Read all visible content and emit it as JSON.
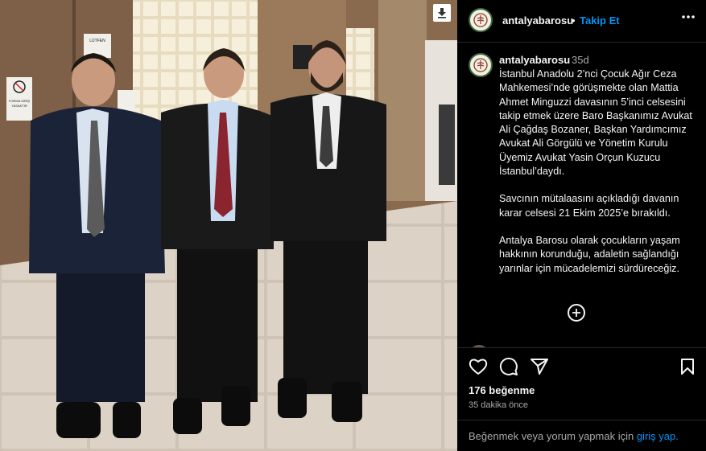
{
  "post": {
    "username": "antalyabarosu",
    "separator": "•",
    "follow_label": "Takip Et",
    "more_label": "•••",
    "caption_time": "35d",
    "caption": [
      "İstanbul Anadolu 2’nci Çocuk Ağır Ceza Mahkemesi’nde görüşmekte olan Mattia Ahmet Minguzzi davasının 5’inci celsesini takip etmek üzere Baro Başkanımız Avukat Ali Çağdaş Bozaner, Başkan Yardımcımız Avukat Ali Görgülü ve Yönetim Kurulu Üyemiz Avukat Yasin Orçun Kuzucu İstanbul’daydı.",
      "Savcının mütalaasını açıkladığı davanın karar celsesi 21 Ekim 2025’e bırakıldı.",
      "Antalya Barosu olarak çocukların yaşam hakkının korunduğu, adaletin sağlandığı yarınlar için mücadelemizi sürdüreceğiz."
    ],
    "likes": "176 beğenme",
    "time_ago": "35 dakika önce",
    "login_prompt": "Beğenmek veya yorum yapmak için",
    "login_link": "giriş yap."
  },
  "photo": {
    "sign_left_line1": "FORMA GİRİŞ",
    "sign_left_line2": "YASAKTIR",
    "sign_center": "LÜTFEN"
  },
  "icons": {
    "like": "heart-icon",
    "comment": "comment-icon",
    "share": "send-icon",
    "save": "bookmark-icon",
    "more": "more-icon",
    "add_comment": "plus-circle-icon",
    "download": "download-icon"
  },
  "colors": {
    "accent": "#0095f6",
    "background": "#000000",
    "text": "#f5f5f5",
    "secondary": "#a8a8a8"
  }
}
